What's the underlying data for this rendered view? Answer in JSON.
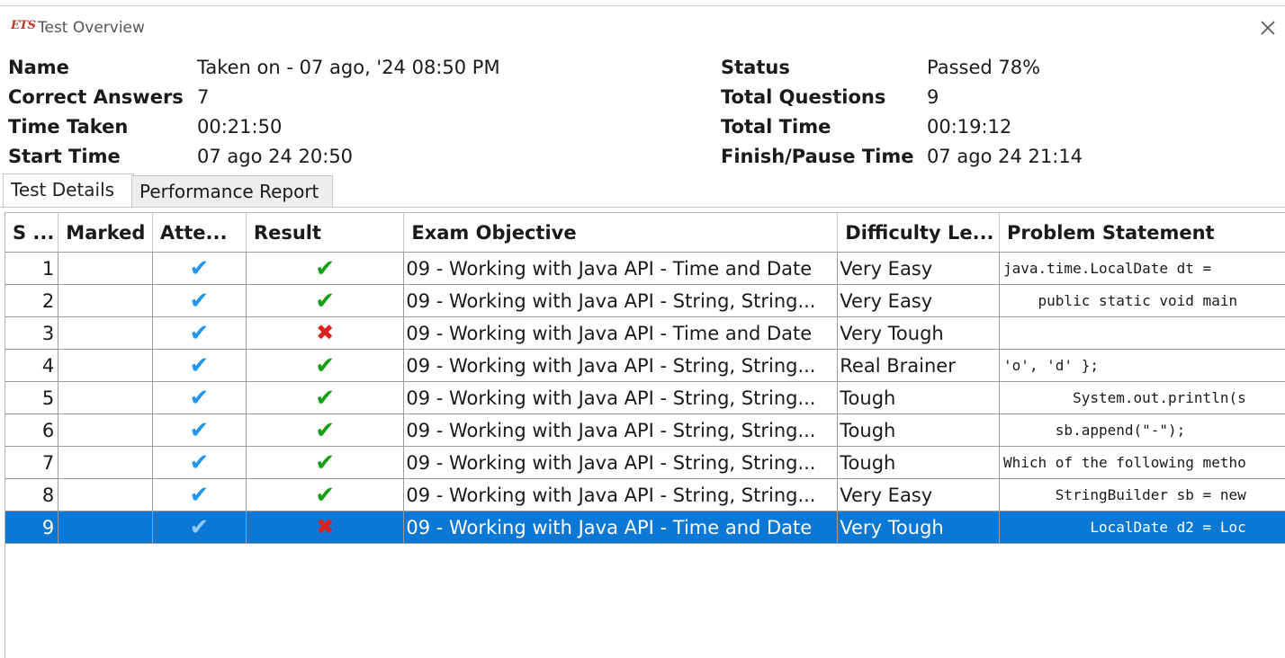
{
  "window": {
    "logo": "ETS",
    "title": "Test Overview"
  },
  "info": {
    "name_label": "Name",
    "name_value": "Taken on - 07 ago, '24 08:50 PM",
    "correct_label": "Correct Answers",
    "correct_value": "7",
    "time_taken_label": "Time Taken",
    "time_taken_value": "00:21:50",
    "start_label": "Start Time",
    "start_value": "07 ago 24 20:50",
    "status_label": "Status",
    "status_value": "Passed 78%",
    "total_q_label": "Total Questions",
    "total_q_value": "9",
    "total_time_label": "Total Time",
    "total_time_value": "00:19:12",
    "finish_label": "Finish/Pause Time",
    "finish_value": "07 ago 24 21:14"
  },
  "tabs": [
    "Test Details",
    "Performance Report"
  ],
  "table": {
    "headers": [
      "S ...",
      "Marked",
      "Atte...",
      "Result",
      "Exam Objective",
      "Difficulty Le...",
      "Problem Statement"
    ],
    "rows": [
      {
        "sn": "1",
        "objective": "09 - Working with Java API - Time and Date",
        "difficulty": "Very Easy",
        "result": "correct",
        "problem": "java.time.LocalDate dt ="
      },
      {
        "sn": "2",
        "objective": "09 - Working with Java API - String, String...",
        "difficulty": "Very Easy",
        "result": "correct",
        "problem": "    public static void main"
      },
      {
        "sn": "3",
        "objective": "09 - Working with Java API - Time and Date",
        "difficulty": "Very Tough",
        "result": "wrong",
        "problem": ""
      },
      {
        "sn": "4",
        "objective": "09 - Working with Java API - String, String...",
        "difficulty": "Real Brainer",
        "result": "correct",
        "problem": "'o', 'd' };"
      },
      {
        "sn": "5",
        "objective": "09 - Working with Java API - String, String...",
        "difficulty": "Tough",
        "result": "correct",
        "problem": "        System.out.println(s"
      },
      {
        "sn": "6",
        "objective": "09 - Working with Java API - String, String...",
        "difficulty": "Tough",
        "result": "correct",
        "problem": "      sb.append(\"-\");"
      },
      {
        "sn": "7",
        "objective": "09 - Working with Java API - String, String...",
        "difficulty": "Tough",
        "result": "correct",
        "problem": "Which of the following metho"
      },
      {
        "sn": "8",
        "objective": "09 - Working with Java API - String, String...",
        "difficulty": "Very Easy",
        "result": "correct",
        "problem": "      StringBuilder sb = new"
      },
      {
        "sn": "9",
        "objective": "09 - Working with Java API - Time and Date",
        "difficulty": "Very Tough",
        "result": "wrong",
        "problem": "          LocalDate d2 = Loc"
      }
    ],
    "attempted_icon": "checkmark-icon",
    "correct_icon": "check-icon",
    "wrong_icon": "cross-icon",
    "selected_row": 9,
    "colors": {
      "selection": "#0a78d4",
      "attempted": "#2196f3",
      "correct": "#16a016",
      "wrong": "#e0201b"
    }
  }
}
